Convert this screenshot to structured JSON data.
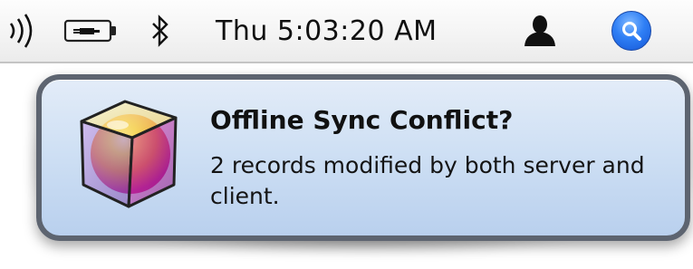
{
  "menubar": {
    "icons": {
      "volume": "volume-icon",
      "battery": "battery-icon",
      "bluetooth": "bluetooth-icon",
      "user": "user-icon",
      "spotlight": "spotlight-search-icon"
    },
    "clock": "Thu 5:03:20 AM",
    "spotlight_color": "#2f7ff5"
  },
  "notification": {
    "icon": "app-cube-icon",
    "title": "Offline Sync Conflict?",
    "message": "2 records modified by both server and client.",
    "background_color": "#cfe0f4",
    "border_color": "#5d6470"
  }
}
